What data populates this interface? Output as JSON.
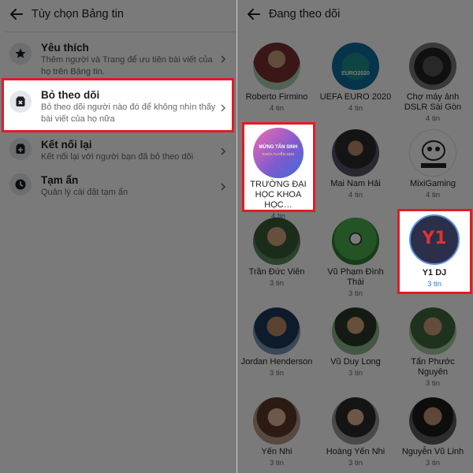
{
  "left": {
    "title": "Tùy chọn Bảng tin",
    "options": [
      {
        "label": "Yêu thích",
        "desc": "Thêm người và Trang để ưu tiên bài viết của họ trên Bảng tin."
      },
      {
        "label": "Bỏ theo dõi",
        "desc": "Bỏ theo dõi người nào đó để không nhìn thấy bài viết của họ nữa"
      },
      {
        "label": "Kết nối lại",
        "desc": "Kết nối lại với người bạn đã bỏ theo dõi"
      },
      {
        "label": "Tạm ẩn",
        "desc": "Quản lý cài đặt tạm ẩn"
      }
    ]
  },
  "right": {
    "title": "Đang theo dõi",
    "profiles": [
      {
        "name": "Roberto  Firmino",
        "count": "4 tin"
      },
      {
        "name": "UEFA EURO 2020",
        "count": "4 tin",
        "avatar_text": "EURO2020"
      },
      {
        "name": "Chợ máy ảnh DSLR Sài Gòn",
        "count": "4 tin"
      },
      {
        "name": "TRƯỜNG ĐẠI HỌC KHOA HỌC…",
        "count": "4 tin",
        "avatar_text": "MỪNG TÂN SINH",
        "avatar_sub": "KHÓA TUYỂN 2020"
      },
      {
        "name": "Mai Nam Hải",
        "count": "4 tin"
      },
      {
        "name": "MixiGaming",
        "count": "4 tin"
      },
      {
        "name": "Trần Đức Viên",
        "count": "3 tin"
      },
      {
        "name": "Vũ Phạm Đình Thái",
        "count": "3 tin"
      },
      {
        "name": "Y1 DJ",
        "count": "3 tin",
        "avatar_text": "Y1"
      },
      {
        "name": "Jordan Henderson",
        "count": "3 tin"
      },
      {
        "name": "Vũ Duy Long",
        "count": "3 tin"
      },
      {
        "name": "Tấn Phước Nguyên",
        "count": "3 tin"
      },
      {
        "name": "Yến Nhi",
        "count": "3 tin"
      },
      {
        "name": "Hoàng Yến Nhi",
        "count": "3 tin"
      },
      {
        "name": "Nguyễn Vũ Linh",
        "count": "3 tin"
      }
    ]
  },
  "colors": {
    "highlight_border": "#e31b23",
    "link_blue": "#3b73c8",
    "overlay": "rgba(0,0,0,0.52)"
  },
  "icons": [
    "back-arrow-icon",
    "star-icon",
    "unfollow-icon",
    "reconnect-icon",
    "clock-icon",
    "chevron-right-icon"
  ]
}
